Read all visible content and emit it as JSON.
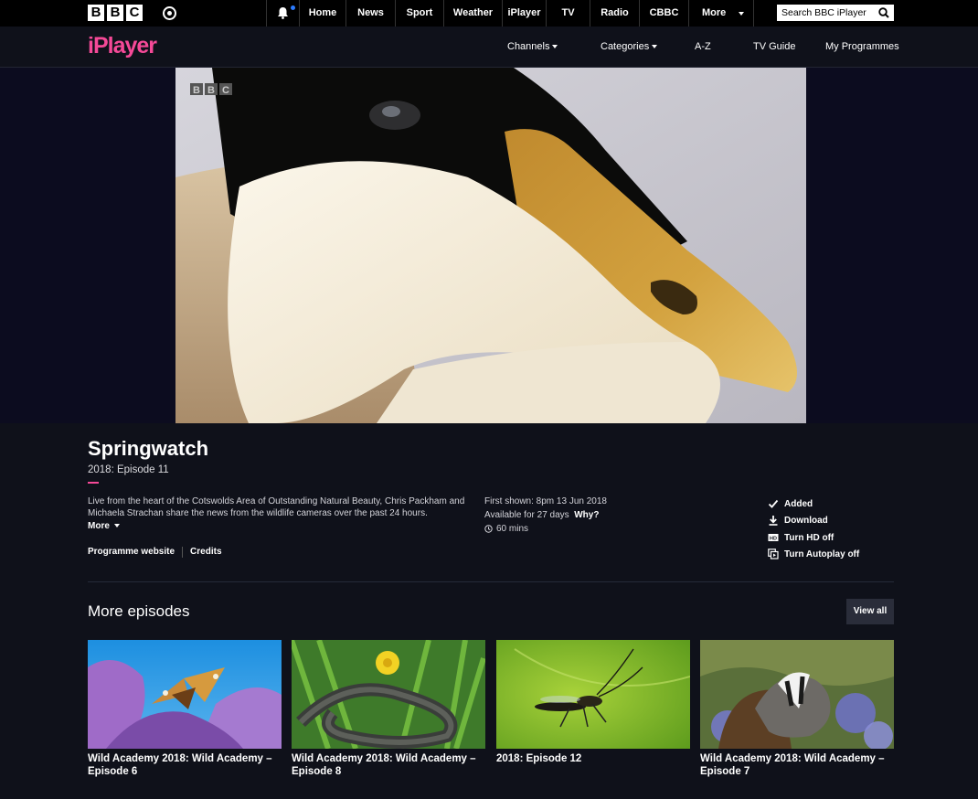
{
  "global_nav": {
    "logo_letters": [
      "B",
      "B",
      "C"
    ],
    "items": [
      "Home",
      "News",
      "Sport",
      "Weather",
      "iPlayer",
      "TV",
      "Radio",
      "CBBC",
      "More"
    ],
    "search_placeholder": "Search BBC iPlayer"
  },
  "iplayer_nav": {
    "logo": "iPlayer",
    "items": [
      "Channels",
      "Categories",
      "A-Z",
      "TV Guide",
      "My Programmes"
    ]
  },
  "player": {
    "watermark": "BBC"
  },
  "programme": {
    "title": "Springwatch",
    "subtitle": "2018: Episode 11",
    "description": "Live from the heart of the Cotswolds Area of Outstanding Natural Beauty, Chris Packham and Michaela Strachan share the news from the wildlife cameras over the past 24 hours.",
    "more_label": "More",
    "first_shown": "First shown: 8pm 13 Jun 2018",
    "available": "Available for 27 days",
    "why_label": "Why?",
    "duration": "60 mins",
    "links": [
      "Programme website",
      "Credits"
    ]
  },
  "actions": [
    "Added",
    "Download",
    "Turn HD off",
    "Turn Autoplay off"
  ],
  "more_episodes": {
    "heading": "More episodes",
    "view_all": "View all",
    "episodes": [
      "Wild Academy 2018: Wild Academy – Episode 6",
      "Wild Academy 2018: Wild Academy – Episode 8",
      "2018: Episode 12",
      "Wild Academy 2018: Wild Academy – Episode 7"
    ]
  },
  "colors": {
    "brand_pink": "#f54997",
    "background": "#0f111a"
  }
}
